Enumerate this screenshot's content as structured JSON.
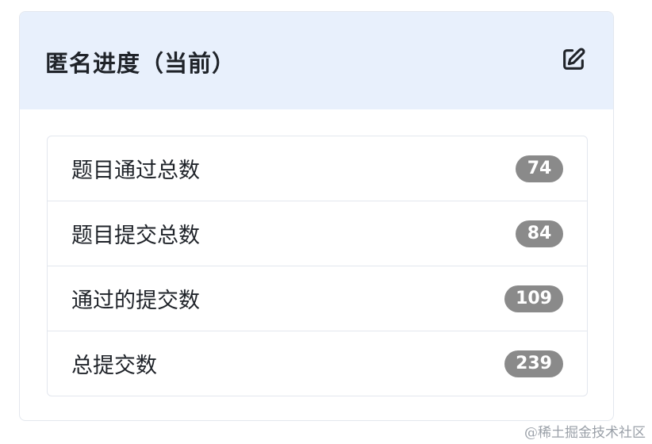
{
  "card": {
    "title": "匿名进度（当前）",
    "edit_icon": "edit-square-pencil-icon",
    "items": [
      {
        "label": "题目通过总数",
        "count": "74"
      },
      {
        "label": "题目提交总数",
        "count": "84"
      },
      {
        "label": "通过的提交数",
        "count": "109"
      },
      {
        "label": "总提交数",
        "count": "239"
      }
    ]
  },
  "colors": {
    "header_bg": "#e8f0fc",
    "badge_bg": "#8a8a8a",
    "border": "#e3e7ee",
    "text": "#1f2329"
  },
  "watermark": "@稀土掘金技术社区"
}
